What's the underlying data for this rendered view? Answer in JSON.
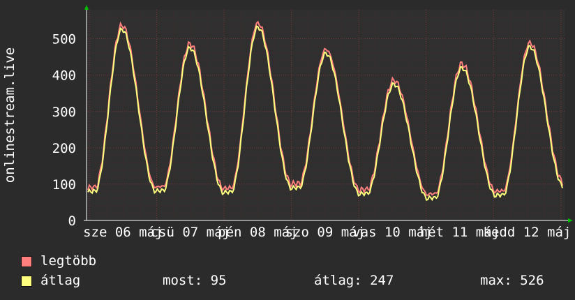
{
  "chart_data": {
    "type": "line",
    "ylabel": "onlinestream.live",
    "ylim": [
      0,
      580
    ],
    "yticks": [
      0,
      100,
      200,
      300,
      400,
      500
    ],
    "grid": true,
    "xticks": [
      "sze 06 máj",
      "csü 07 máj",
      "pén 08 máj",
      "szo 09 máj",
      "vas 10 máj",
      "hét 11 máj",
      "kedd 12 máj"
    ],
    "day_peaks": [
      {
        "peak": 526,
        "trough": 78
      },
      {
        "peak": 475,
        "trough": 80
      },
      {
        "peak": 532,
        "trough": 76
      },
      {
        "peak": 460,
        "trough": 88
      },
      {
        "peak": 375,
        "trough": 72
      },
      {
        "peak": 420,
        "trough": 60
      },
      {
        "peak": 478,
        "trough": 68
      }
    ],
    "series": [
      {
        "name": "legtöbb",
        "color": "#ff7f7f"
      },
      {
        "name": "átlag",
        "color": "#ffff7f"
      }
    ]
  },
  "legend": {
    "max_label": "legtöbb",
    "avg_label": "átlag",
    "stats": {
      "now": "most: 95",
      "avg": "átlag: 247",
      "max": "max: 526"
    }
  }
}
